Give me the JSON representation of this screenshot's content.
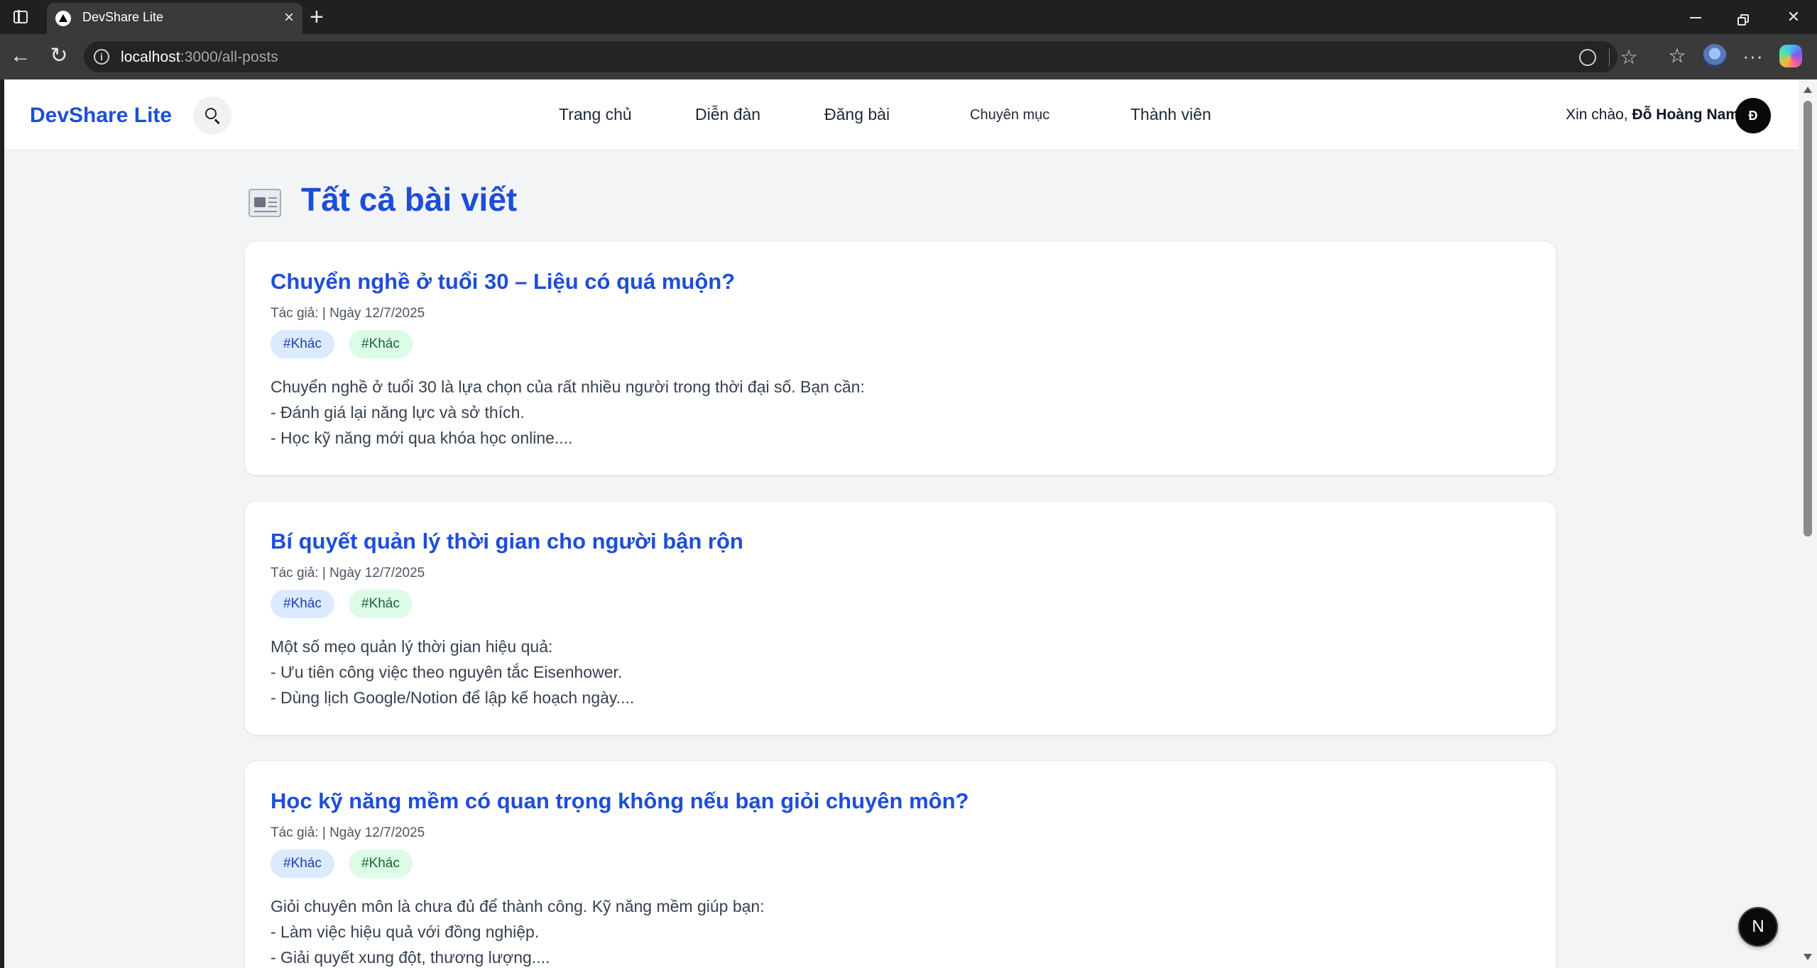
{
  "browser": {
    "tab_title": "DevShare Lite",
    "tab_close": "×",
    "new_tab": "+",
    "url_host": "localhost",
    "url_path": ":3000/all-posts"
  },
  "header": {
    "logo": "DevShare Lite",
    "nav": {
      "home": "Trang chủ",
      "forum": "Diễn đàn",
      "post": "Đăng bài",
      "categories": "Chuyên mục",
      "members": "Thành viên"
    },
    "greeting_prefix": "Xin chào,",
    "user_name": "Đỗ Hoàng Nam",
    "avatar_initial": "Đ"
  },
  "page": {
    "title": "Tất cả bài viết"
  },
  "posts": [
    {
      "title": "Chuyển nghề ở tuổi 30 – Liệu có quá muộn?",
      "meta": "Tác giả: | Ngày 12/7/2025",
      "tag1": "#Khác",
      "tag2": "#Khác",
      "line1": "Chuyển nghề ở tuổi 30 là lựa chọn của rất nhiều người trong thời đại số. Bạn cần:",
      "line2": "- Đánh giá lại năng lực và sở thích.",
      "line3": "- Học kỹ năng mới qua khóa học online...."
    },
    {
      "title": "Bí quyết quản lý thời gian cho người bận rộn",
      "meta": "Tác giả: | Ngày 12/7/2025",
      "tag1": "#Khác",
      "tag2": "#Khác",
      "line1": "Một số mẹo quản lý thời gian hiệu quả:",
      "line2": "- Ưu tiên công việc theo nguyên tắc Eisenhower.",
      "line3": "- Dùng lịch Google/Notion để lập kế hoạch ngày...."
    },
    {
      "title": "Học kỹ năng mềm có quan trọng không nếu bạn giỏi chuyên môn?",
      "meta": "Tác giả: | Ngày 12/7/2025",
      "tag1": "#Khác",
      "tag2": "#Khác",
      "line1": "Giỏi chuyên môn là chưa đủ để thành công. Kỹ năng mềm giúp bạn:",
      "line2": "- Làm việc hiệu quả với đồng nghiệp.",
      "line3": "- Giải quyết xung đột, thương lượng...."
    }
  ],
  "dev_badge": "N",
  "colors": {
    "brand": "#1d4ed8",
    "tag_blue_bg": "#dbeafe",
    "tag_green_bg": "#dcfce7",
    "page_bg": "#f3f4f6"
  }
}
